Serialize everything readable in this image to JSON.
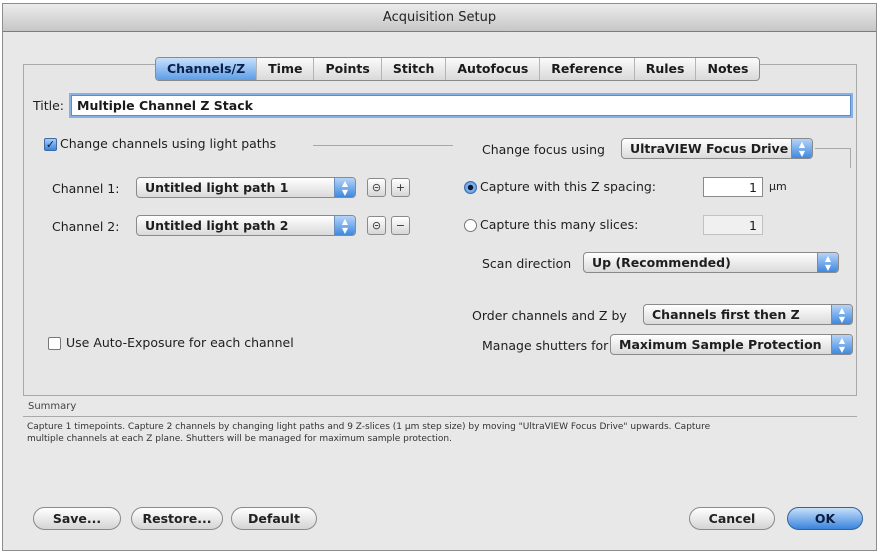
{
  "window": {
    "title": "Acquisition Setup"
  },
  "tabs": [
    "Channels/Z",
    "Time",
    "Points",
    "Stitch",
    "Autofocus",
    "Reference",
    "Rules",
    "Notes"
  ],
  "title_field": {
    "label": "Title:",
    "value": "Multiple Channel Z Stack"
  },
  "channels": {
    "checkbox_label": "Change channels using light paths",
    "checked": true,
    "rows": [
      {
        "label": "Channel 1:",
        "value": "Untitled light path 1",
        "btn_a": "⊝",
        "btn_b": "+"
      },
      {
        "label": "Channel 2:",
        "value": "Untitled light path 2",
        "btn_a": "⊝",
        "btn_b": "−"
      }
    ],
    "auto_exposure_label": "Use Auto-Exposure for each channel"
  },
  "focus": {
    "label": "Change focus using",
    "value": "UltraVIEW Focus Drive",
    "spacing_label": "Capture with this Z spacing:",
    "spacing_value": "1",
    "spacing_unit": "µm",
    "slices_label": "Capture this many slices:",
    "slices_value": "1",
    "scan_label": "Scan direction",
    "scan_value": "Up (Recommended)"
  },
  "order": {
    "label": "Order channels and Z by",
    "value": "Channels first then Z"
  },
  "shutters": {
    "label": "Manage shutters for",
    "value": "Maximum Sample Protection"
  },
  "summary": {
    "heading": "Summary",
    "line1": "Capture 1 timepoints.  Capture 2 channels by changing light paths and 9 Z-slices (1 µm step size) by moving \"UltraVIEW Focus Drive\" upwards.  Capture",
    "line2": "multiple channels at each Z plane.  Shutters will be managed for maximum sample protection."
  },
  "buttons": {
    "save": "Save...",
    "restore": "Restore...",
    "default": "Default",
    "cancel": "Cancel",
    "ok": "OK"
  },
  "colors": {
    "accent": "#3a84dc",
    "window_bg": "#e8e8e8"
  }
}
